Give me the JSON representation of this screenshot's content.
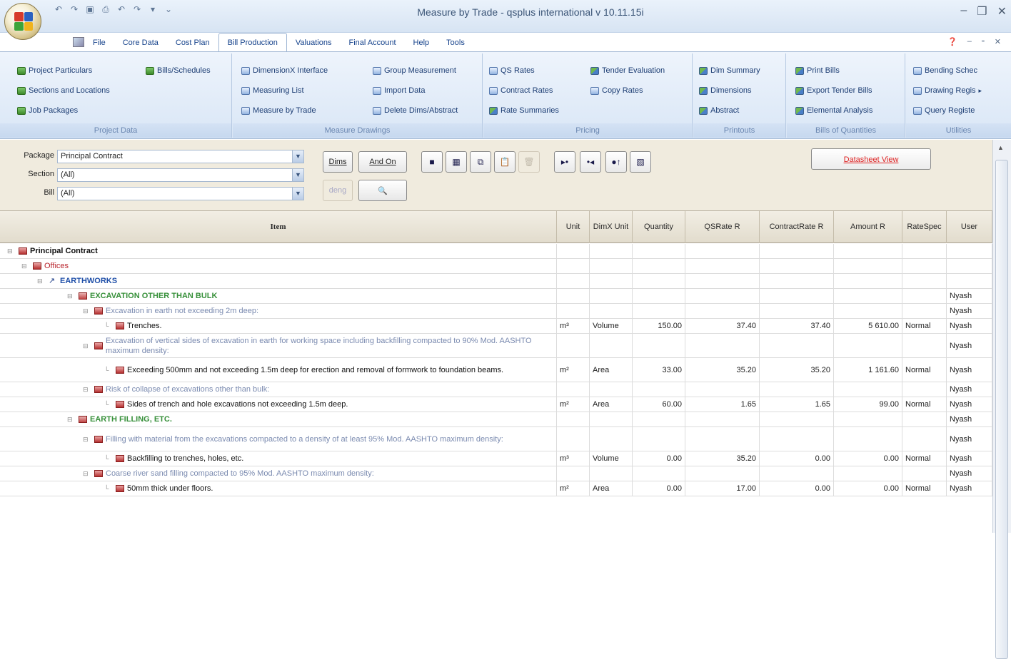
{
  "app": {
    "title": "Measure by Trade - qsplus international v 10.11.15i",
    "colors": {
      "accent": "#15428b",
      "ribbon_bg": "#dfe9f5",
      "filter_bg": "#f0ebde",
      "datasheet_text": "#dd2222"
    }
  },
  "qat": {
    "icons": [
      "undo-icon",
      "redo-icon",
      "save-icon",
      "print-icon",
      "undo2-icon",
      "redo2-icon",
      "filter-icon",
      "customize-icon"
    ]
  },
  "menu": {
    "tabs": [
      {
        "label": "File"
      },
      {
        "label": "Core Data"
      },
      {
        "label": "Cost Plan"
      },
      {
        "label": "Bill Production"
      },
      {
        "label": "Valuations"
      },
      {
        "label": "Final Account"
      },
      {
        "label": "Help"
      },
      {
        "label": "Tools"
      }
    ],
    "active": "Bill Production"
  },
  "ribbon": {
    "project_data": {
      "label": "Project Data",
      "items": [
        "Project Particulars",
        "Bills/Schedules",
        "Sections and Locations",
        "Job Packages"
      ]
    },
    "measure_drawings": {
      "label": "Measure Drawings",
      "items": [
        "DimensionX Interface",
        "Group Measurement",
        "Measuring List",
        "Import Data",
        "Measure by Trade",
        "Delete Dims/Abstract"
      ]
    },
    "pricing": {
      "label": "Pricing",
      "items": [
        "QS Rates",
        "Tender Evaluation",
        "Contract Rates",
        "Copy Rates",
        "Rate Summaries"
      ]
    },
    "printouts": {
      "label": "Printouts",
      "items": [
        "Dim Summary",
        "Dimensions",
        "Abstract"
      ]
    },
    "bills": {
      "label": "Bills of Quantities",
      "items": [
        "Print Bills",
        "Export Tender Bills",
        "Elemental Analysis"
      ]
    },
    "utilities": {
      "label": "Utilities",
      "items": [
        "Bending Schec",
        "Drawing Regis",
        "Query Registe"
      ]
    }
  },
  "filter": {
    "package_label": "Package",
    "package_value": "Principal Contract",
    "section_label": "Section",
    "section_value": "(All)",
    "bill_label": "Bill",
    "bill_value": "(All)",
    "dims_button": "Dims",
    "andon_button": "And On",
    "deng_button": "deng",
    "datasheet_button": "Datasheet View"
  },
  "grid": {
    "columns": [
      "Item",
      "Unit",
      "DimX Unit",
      "Quantity",
      "QSRate R",
      "ContractRate R",
      "Amount R",
      "RateSpec",
      "User"
    ],
    "rows": [
      {
        "level": 0,
        "item": "Principal Contract",
        "unit": "",
        "dimx": "",
        "qty": "",
        "qsrate": "",
        "crate": "",
        "amount": "",
        "ratespec": "",
        "user": ""
      },
      {
        "level": 1,
        "item": "Offices",
        "unit": "",
        "dimx": "",
        "qty": "",
        "qsrate": "",
        "crate": "",
        "amount": "",
        "ratespec": "",
        "user": ""
      },
      {
        "level": 2,
        "item": "EARTHWORKS",
        "unit": "",
        "dimx": "",
        "qty": "",
        "qsrate": "",
        "crate": "",
        "amount": "",
        "ratespec": "",
        "user": ""
      },
      {
        "level": 3,
        "item": "EXCAVATION OTHER THAN BULK",
        "unit": "",
        "dimx": "",
        "qty": "",
        "qsrate": "",
        "crate": "",
        "amount": "",
        "ratespec": "",
        "user": "Nyash"
      },
      {
        "level": 4,
        "item": "Excavation in earth not exceeding 2m deep:",
        "unit": "",
        "dimx": "",
        "qty": "",
        "qsrate": "",
        "crate": "",
        "amount": "",
        "ratespec": "",
        "user": "Nyash"
      },
      {
        "level": 5,
        "item": "Trenches.",
        "unit": "m³",
        "dimx": "Volume",
        "qty": "150.00",
        "qsrate": "37.40",
        "crate": "37.40",
        "amount": "5 610.00",
        "ratespec": "Normal",
        "user": "Nyash"
      },
      {
        "level": 4,
        "item": "Excavation of vertical sides of excavation in earth for working space including backfilling compacted to 90% Mod. AASHTO maximum density:",
        "unit": "",
        "dimx": "",
        "qty": "",
        "qsrate": "",
        "crate": "",
        "amount": "",
        "ratespec": "",
        "user": "Nyash"
      },
      {
        "level": 5,
        "item": "Exceeding 500mm and not exceeding 1.5m deep for erection and removal of formwork to foundation beams.",
        "unit": "m²",
        "dimx": "Area",
        "qty": "33.00",
        "qsrate": "35.20",
        "crate": "35.20",
        "amount": "1 161.60",
        "ratespec": "Normal",
        "user": "Nyash"
      },
      {
        "level": 4,
        "item": "Risk of collapse of excavations other than bulk:",
        "unit": "",
        "dimx": "",
        "qty": "",
        "qsrate": "",
        "crate": "",
        "amount": "",
        "ratespec": "",
        "user": "Nyash"
      },
      {
        "level": 5,
        "item": "Sides of trench and hole excavations not exceeding 1.5m deep.",
        "unit": "m²",
        "dimx": "Area",
        "qty": "60.00",
        "qsrate": "1.65",
        "crate": "1.65",
        "amount": "99.00",
        "ratespec": "Normal",
        "user": "Nyash"
      },
      {
        "level": 3,
        "item": "EARTH FILLING, ETC.",
        "unit": "",
        "dimx": "",
        "qty": "",
        "qsrate": "",
        "crate": "",
        "amount": "",
        "ratespec": "",
        "user": "Nyash"
      },
      {
        "level": 4,
        "item": "Filling with material from the excavations compacted to a density of at least 95% Mod. AASHTO maximum density:",
        "unit": "",
        "dimx": "",
        "qty": "",
        "qsrate": "",
        "crate": "",
        "amount": "",
        "ratespec": "",
        "user": "Nyash"
      },
      {
        "level": 5,
        "item": "Backfilling to trenches, holes, etc.",
        "unit": "m³",
        "dimx": "Volume",
        "qty": "0.00",
        "qsrate": "35.20",
        "crate": "0.00",
        "amount": "0.00",
        "ratespec": "Normal",
        "user": "Nyash"
      },
      {
        "level": 4,
        "item": "Coarse river sand filling compacted to 95% Mod. AASHTO maximum density:",
        "unit": "",
        "dimx": "",
        "qty": "",
        "qsrate": "",
        "crate": "",
        "amount": "",
        "ratespec": "",
        "user": "Nyash"
      },
      {
        "level": 5,
        "item": "50mm thick under floors.",
        "unit": "m²",
        "dimx": "Area",
        "qty": "0.00",
        "qsrate": "17.00",
        "crate": "0.00",
        "amount": "0.00",
        "ratespec": "Normal",
        "user": "Nyash"
      }
    ]
  }
}
